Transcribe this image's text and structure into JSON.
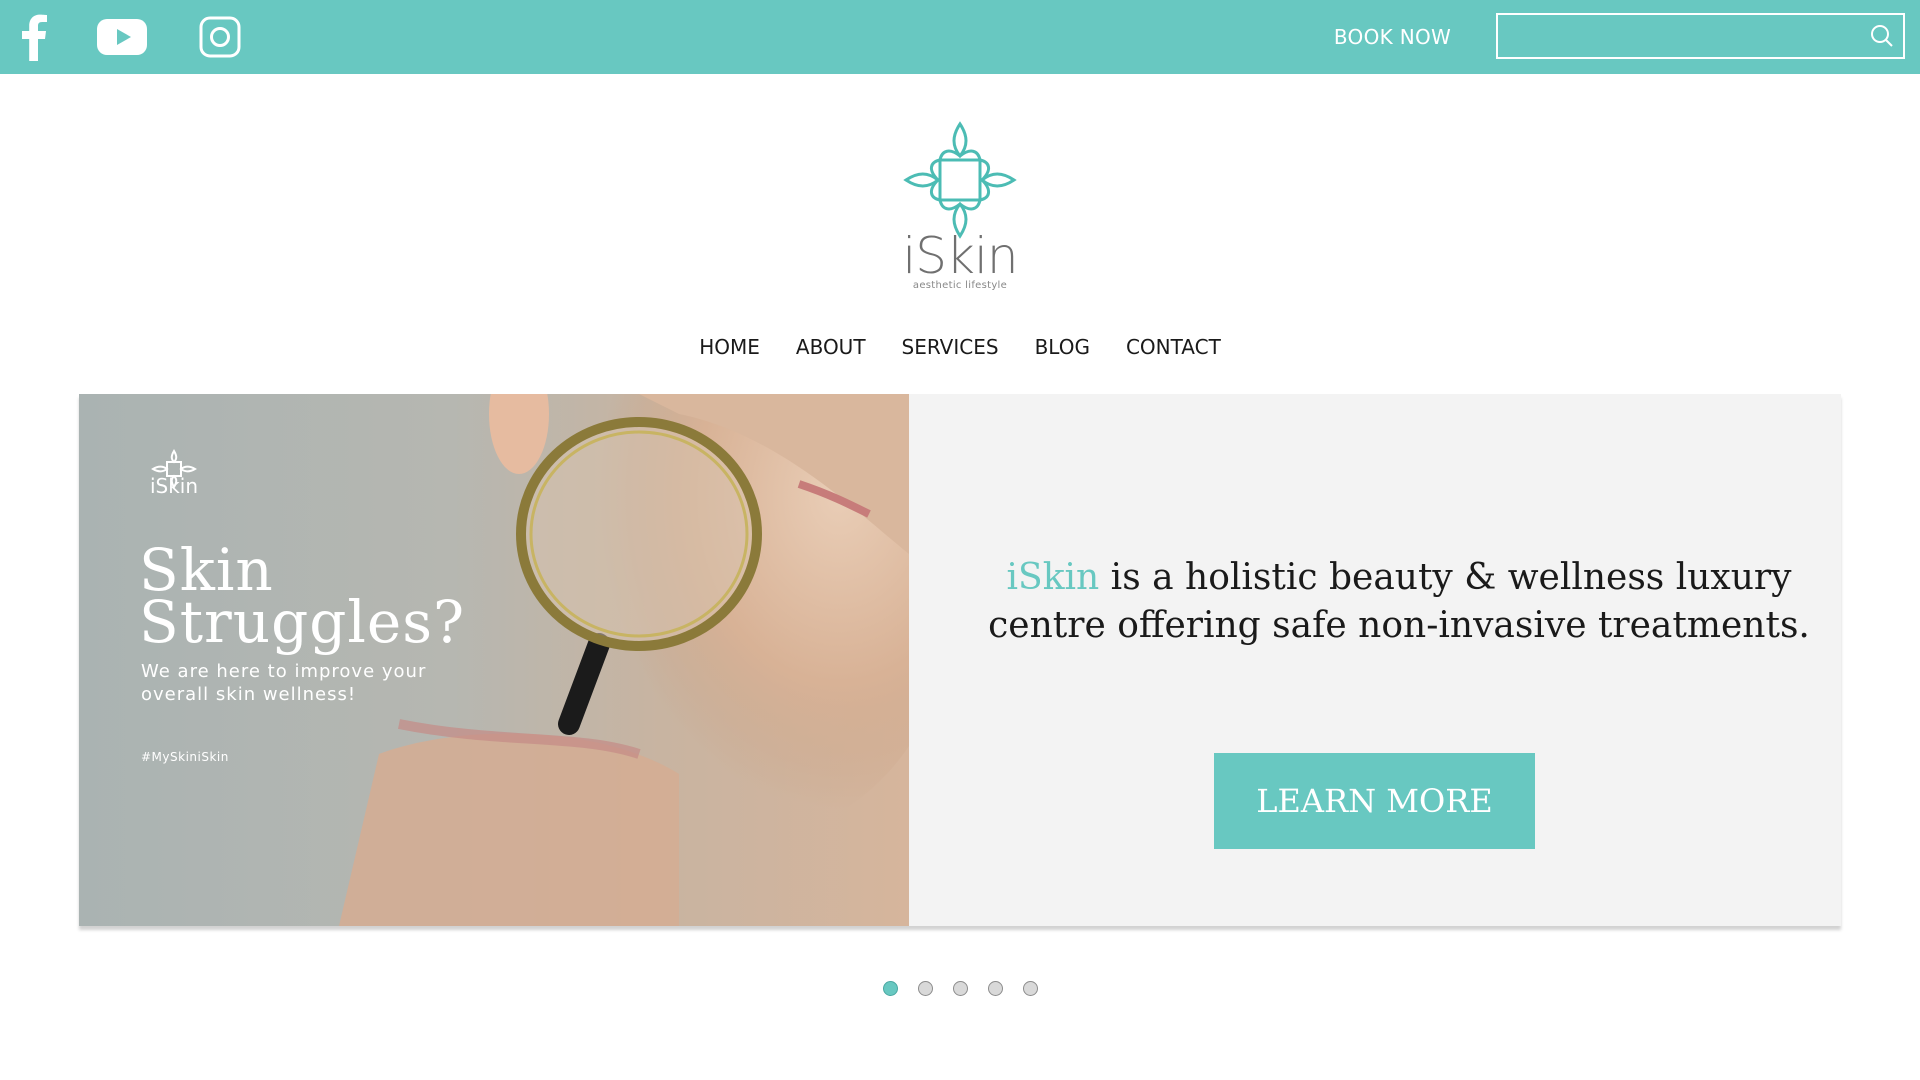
{
  "topbar": {
    "social": [
      {
        "name": "facebook-icon"
      },
      {
        "name": "youtube-icon"
      },
      {
        "name": "instagram-icon"
      }
    ],
    "book_now": "BOOK NOW",
    "search": {
      "value": "",
      "placeholder": ""
    }
  },
  "logo": {
    "wordmark": "iSkin",
    "tagline": "aesthetic lifestyle"
  },
  "nav": {
    "items": [
      {
        "label": "HOME"
      },
      {
        "label": "ABOUT"
      },
      {
        "label": "SERVICES"
      },
      {
        "label": "BLOG"
      },
      {
        "label": "CONTACT"
      }
    ]
  },
  "hero": {
    "image": {
      "logo_text": "iSkin",
      "headline_line1": "Skin",
      "headline_line2": "Struggles?",
      "subline": "We are here to improve your overall skin wellness!",
      "hashtag": "#MySkiniSkin"
    },
    "copy_brand": "iSkin",
    "copy_text": " is a holistic beauty & wellness luxury centre offering safe non-invasive treatments.",
    "button": "LEARN MORE"
  },
  "slider": {
    "count": 5,
    "active": 1
  },
  "colors": {
    "accent": "#68c8c1",
    "text": "#1a1a1a",
    "panel": "#f3f3f3"
  }
}
